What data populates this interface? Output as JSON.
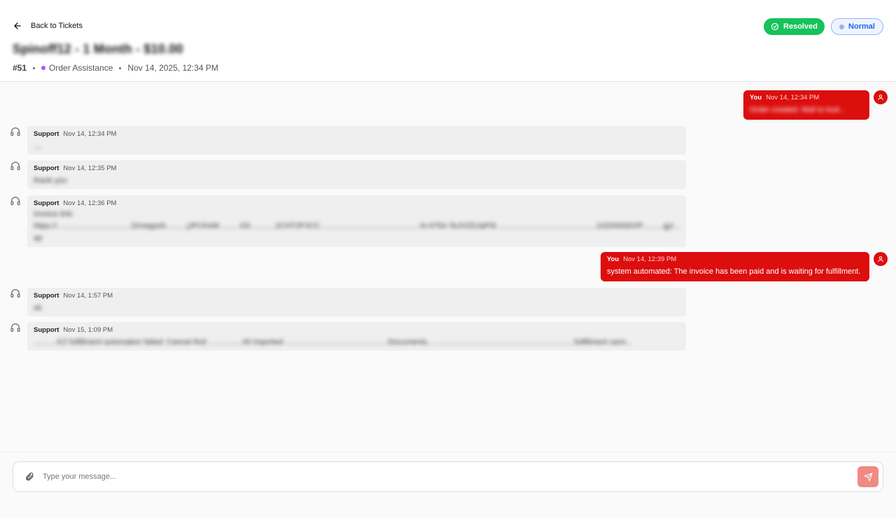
{
  "header": {
    "back_label": "Back to Tickets",
    "title": "Spinoff12 - 1 Month - $10.00",
    "ticket_number": "#51",
    "category": "Order Assistance",
    "created": "Nov 14, 2025, 12:34 PM",
    "status_label": "Resolved",
    "priority_label": "Normal"
  },
  "messages": [
    {
      "author": "You",
      "time": "Nov 14, 12:34 PM",
      "text": "Order created. Mail to bud..."
    },
    {
      "author": "Support",
      "time": "Nov 14, 12:34 PM",
      "text": "...."
    },
    {
      "author": "Support",
      "time": "Nov 14, 12:35 PM",
      "text": "thank you"
    },
    {
      "author": "Support",
      "time": "Nov 14, 12:36 PM",
      "text": "Invoice link:",
      "link": "https://...................................Dmwgsoh..........jJFCKeM..........iOl............2CHT2PJCC...............................................N-475A-TeJVZDJaP0l...............................................1020000DOP..........gjJ...ap"
    },
    {
      "author": "You",
      "time": "Nov 14, 12:39 PM",
      "text": "system automated: The invoice has been paid and is waiting for fulfillment."
    },
    {
      "author": "Support",
      "time": "Nov 14, 1:57 PM",
      "text": "ok"
    },
    {
      "author": "Support",
      "time": "Nov 15, 1:09 PM",
      "text": "...........KZ fulfillment automation failed: Cannot find ................00 imported ................................................Documents, ...................................................................fulfillment cann..."
    }
  ],
  "composer": {
    "placeholder": "Type your message..."
  },
  "colors": {
    "accent_red": "#dc0e0e",
    "resolved_green": "#16c25b",
    "normal_blue": "#2563eb",
    "category_purple": "#a855f7"
  },
  "icons": [
    "arrow-left-icon",
    "check-circle-icon",
    "headset-icon",
    "user-icon",
    "paperclip-icon",
    "send-icon"
  ]
}
